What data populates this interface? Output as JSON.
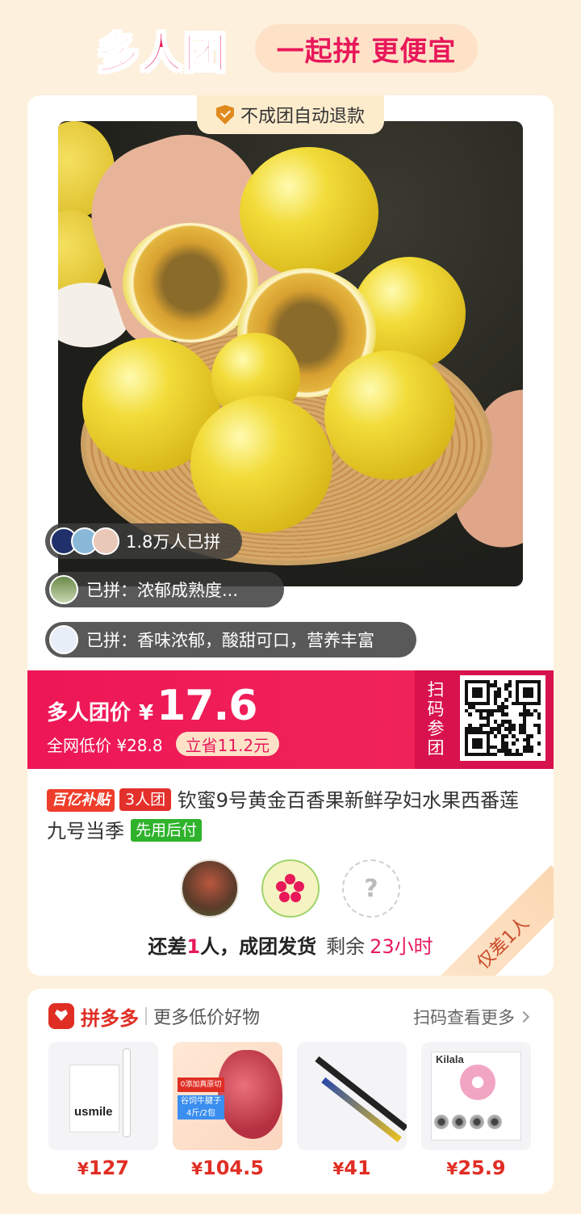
{
  "header": {
    "logo_text": "多人团",
    "slogan": "一起拼 更便宜"
  },
  "card": {
    "refund_tag": "不成团自动退款",
    "badges": {
      "joined_count": "1.8万人已拼",
      "review_1": "已拼：浓郁成熟度...",
      "review_2": "已拼：香味浓郁，酸甜可口，营养丰富"
    },
    "price": {
      "label": "多人团价",
      "currency": "¥",
      "amount": "17.6",
      "reference": "全网低价 ¥28.8",
      "savings": "立省11.2元",
      "scan_label": "扫码参团"
    },
    "title": {
      "tag_subsidy": "百亿补贴",
      "tag_group": "3人团",
      "text": "钦蜜9号黄金百香果新鲜孕妇水果西番莲九号当季",
      "tag_pay": "先用后付"
    },
    "members": {
      "unknown_mark": "?"
    },
    "status": {
      "prefix": "还差",
      "count": "1",
      "suffix": "人，成团发货",
      "remaining_label": "剩余",
      "remaining_time": "23小时"
    },
    "ribbon": "仅差1人"
  },
  "footer": {
    "brand": "拼多多",
    "subtitle": "更多低价好物",
    "more": "扫码查看更多",
    "goods": [
      {
        "name": "usmile toothbrush",
        "image_text": "usmile",
        "price": "127"
      },
      {
        "name": "beef",
        "image_text_1": "0添加真原切",
        "image_text_2": "谷饲牛腱子 4斤/2包",
        "price": "104.5"
      },
      {
        "name": "wiper blade",
        "price": "41"
      },
      {
        "name": "kilala contact lenses",
        "image_text": "Kilala",
        "price": "25.9"
      }
    ]
  },
  "colors": {
    "brand_red": "#e8185a",
    "price_banner": "#ee1656",
    "page_bg": "#fdf0dc"
  }
}
